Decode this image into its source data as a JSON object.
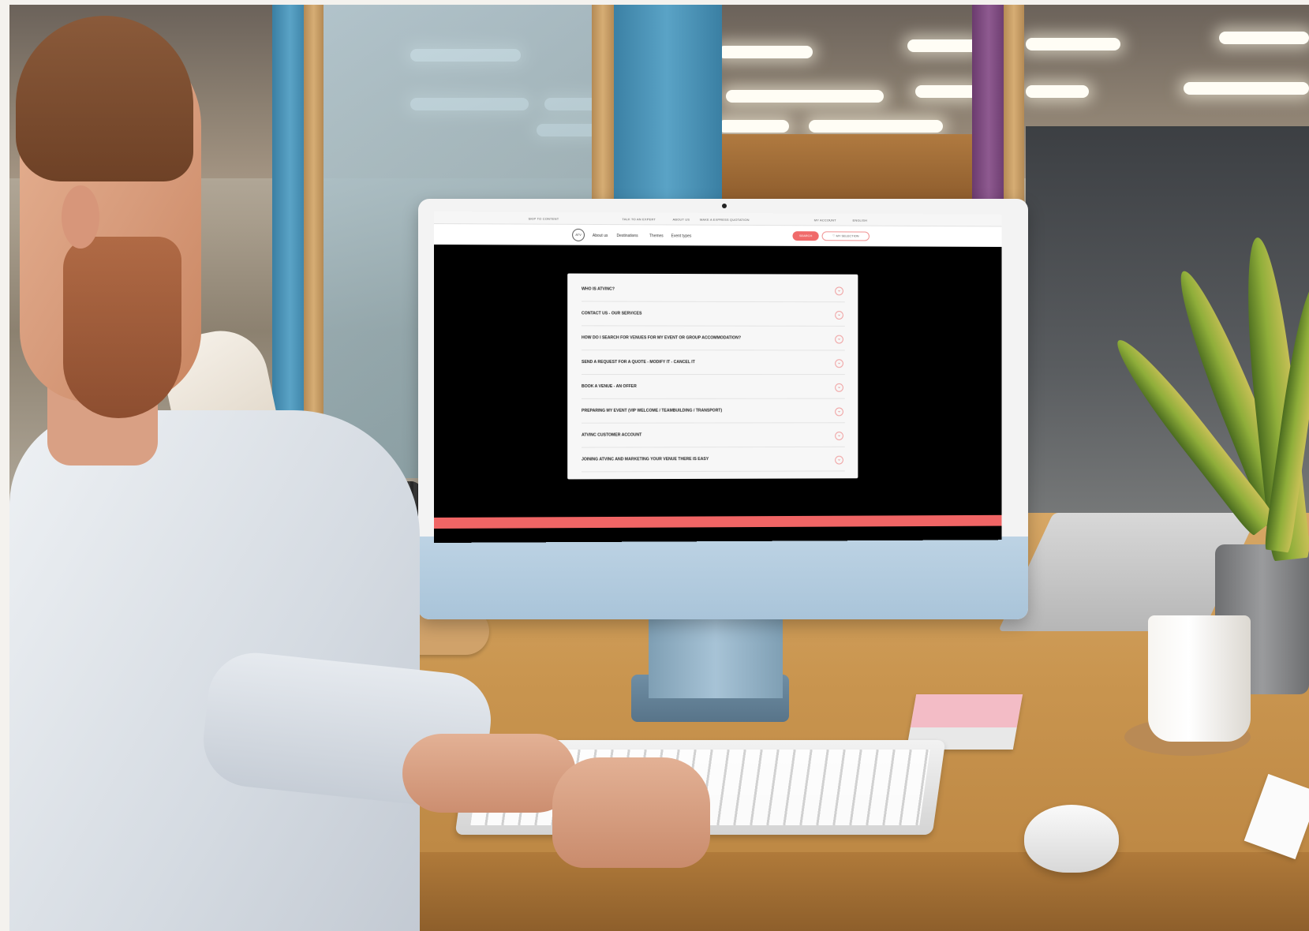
{
  "screen": {
    "topbar": {
      "skip": "SKIP TO CONTENT",
      "talk": "TALK TO AN EXPERT",
      "about": "ABOUT US",
      "quote": "MAKE A EXPRESS QUOTATION",
      "account": "MY ACCOUNT",
      "language": "ENGLISH"
    },
    "nav": {
      "logo": "ATV",
      "links": [
        "About us",
        "Destinations",
        "Themes",
        "Event types"
      ],
      "search_label": "SEARCH",
      "selection_label": "MY SELECTION"
    },
    "faq": [
      "WHO IS ATVINC?",
      "CONTACT US - OUR SERVICES",
      "HOW DO I SEARCH FOR VENUES FOR MY EVENT OR GROUP ACCOMMODATION?",
      "SEND A REQUEST FOR A QUOTE - MODIFY IT - CANCEL IT",
      "BOOK A VENUE - AN OFFER",
      "PREPARING MY EVENT (VIP WELCOME / TEAMBUILDING / TRANSPORT)",
      "ATVINC CUSTOMER ACCOUNT",
      "JOINING ATVINC AND MARKETING YOUR VENUE THERE IS EASY"
    ],
    "colors": {
      "accent": "#f06565",
      "screen_bg": "#000000",
      "panel": "#f7f7f7"
    }
  },
  "icons": {
    "faq_toggle": "chevron-down-icon",
    "selection": "heart-icon"
  }
}
